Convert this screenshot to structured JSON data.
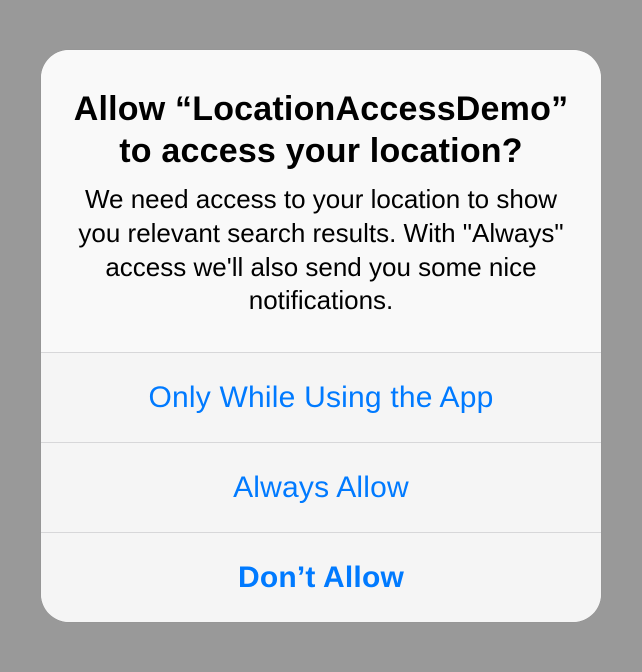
{
  "alert": {
    "title": "Allow “LocationAccessDemo” to access your location?",
    "message": "We need access to your location to show you relevant search results. With \"Always\" access we'll also send you some nice notifications.",
    "actions": {
      "only_while_using": "Only While Using the App",
      "always_allow": "Always Allow",
      "dont_allow": "Don’t Allow"
    }
  },
  "colors": {
    "button_tint": "#007aff"
  }
}
